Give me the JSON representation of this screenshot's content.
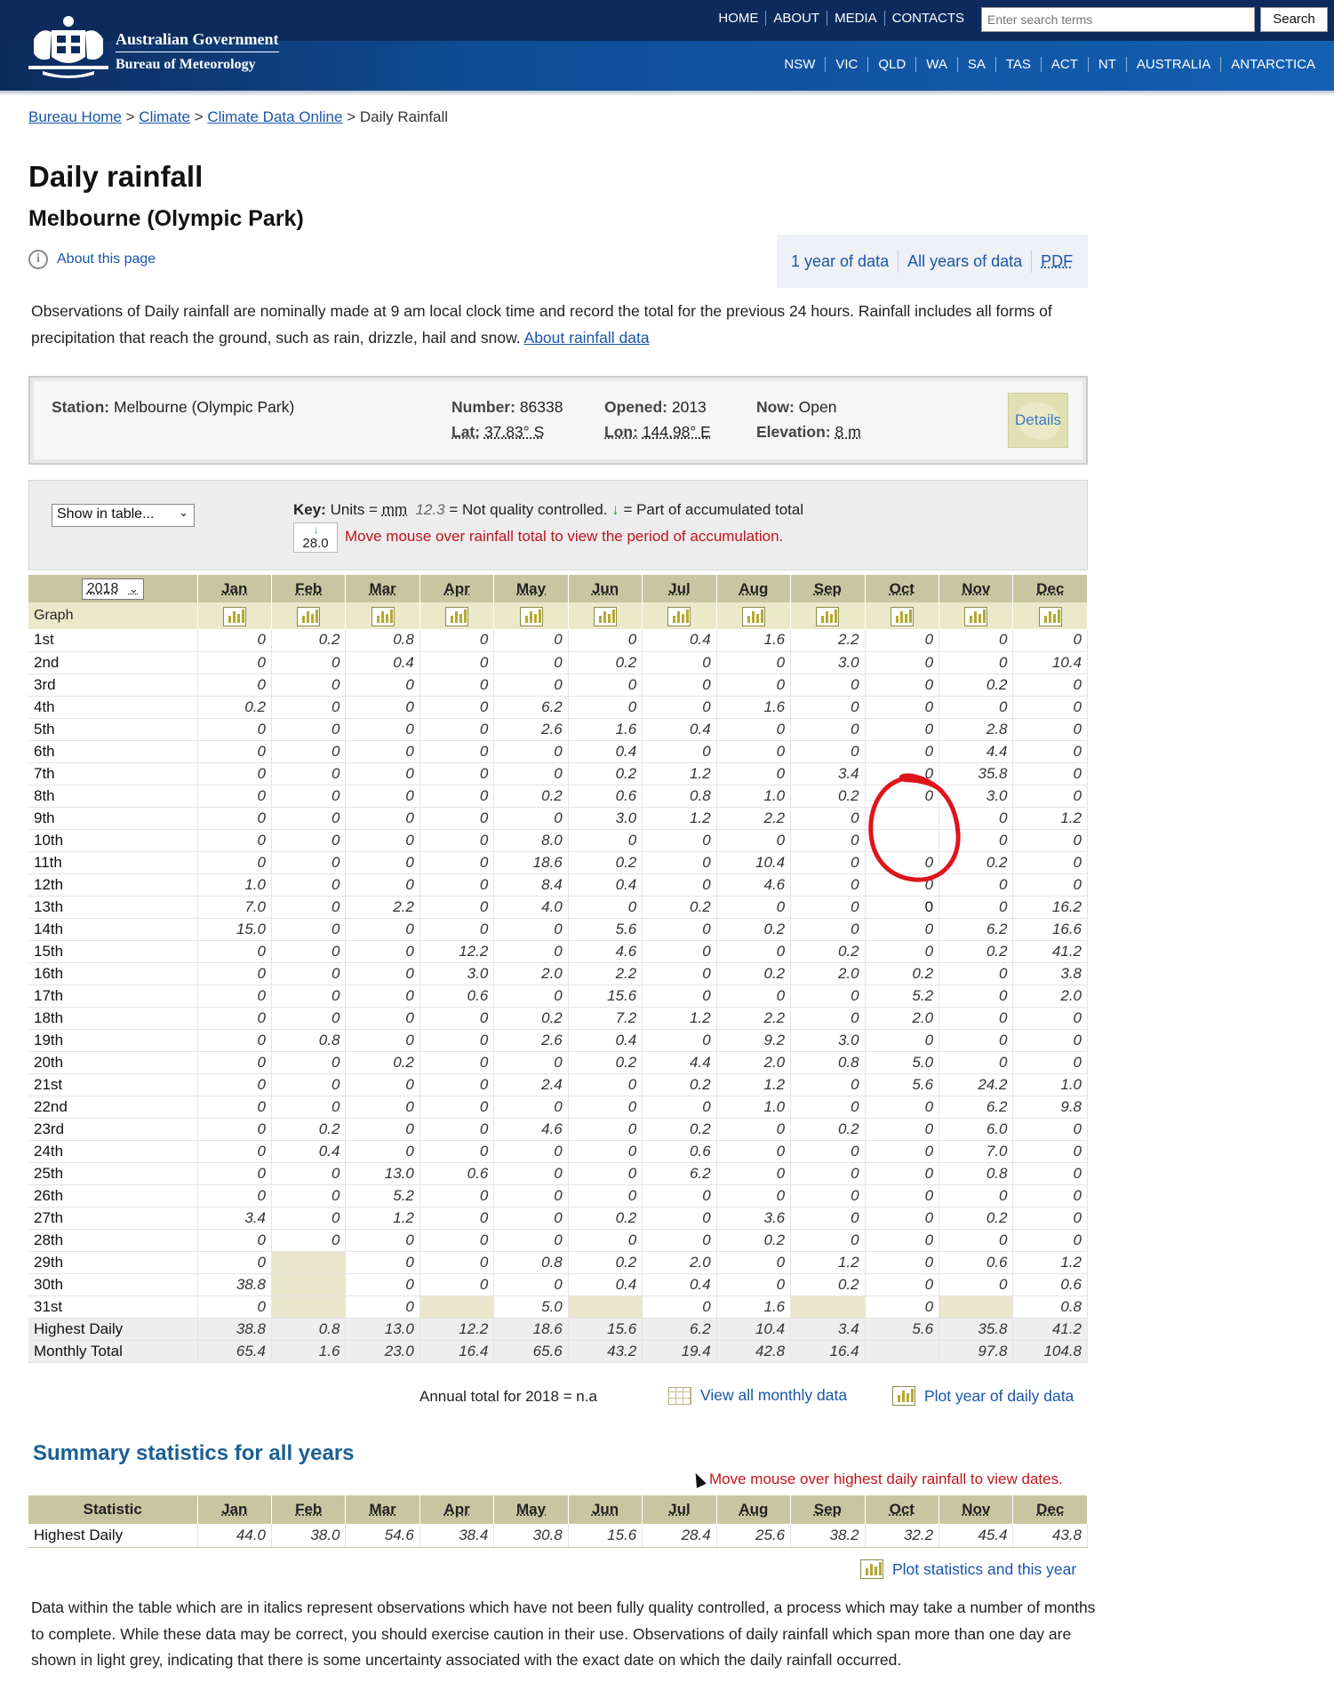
{
  "header": {
    "gov_title": "Australian Government",
    "gov_subtitle": "Bureau of Meteorology",
    "top_nav": [
      "HOME",
      "ABOUT",
      "MEDIA",
      "CONTACTS"
    ],
    "search_placeholder": "Enter search terms",
    "search_button": "Search",
    "state_nav": [
      "NSW",
      "VIC",
      "QLD",
      "WA",
      "SA",
      "TAS",
      "ACT",
      "NT",
      "AUSTRALIA",
      "ANTARCTICA"
    ]
  },
  "breadcrumb": {
    "home": "Bureau Home",
    "climate": "Climate",
    "cdo": "Climate Data Online",
    "sep": ">",
    "current": "Daily Rainfall"
  },
  "page": {
    "title": "Daily rainfall",
    "subtitle": "Melbourne (Olympic Park)",
    "about_link": "About this page",
    "link_1year": "1 year of data",
    "link_allyears": "All years of data",
    "link_pdf": "PDF",
    "intro": "Observations of Daily rainfall are nominally made at 9 am local clock time and record the total for the previous 24 hours. Rainfall includes all forms of precipitation that reach the ground, such as rain, drizzle, hail and snow.",
    "intro_link": "About rainfall data"
  },
  "station": {
    "station_label": "Station:",
    "station_value": "Melbourne (Olympic Park)",
    "number_label": "Number:",
    "number_value": "86338",
    "opened_label": "Opened:",
    "opened_value": "2013",
    "now_label": "Now:",
    "now_value": "Open",
    "lat_label": "Lat:",
    "lat_value": "37.83° S",
    "lon_label": "Lon:",
    "lon_value": "144.98° E",
    "elev_label": "Elevation:",
    "elev_value": "8 m",
    "details_button": "Details"
  },
  "key": {
    "show_select": "Show in table...",
    "key_label": "Key:",
    "units_text": "Units =",
    "units_value": "mm",
    "qc_example": "12.3",
    "qc_text": "= Not quality controlled.",
    "acc_arrow": "↓",
    "acc_text": "= Part of accumulated total",
    "acc_example": "28.0",
    "acc_msg": "Move mouse over rainfall total to view the period of accumulation."
  },
  "table": {
    "year": "2018",
    "graph_label": "Graph",
    "months": [
      "Jan",
      "Feb",
      "Mar",
      "Apr",
      "May",
      "Jun",
      "Jul",
      "Aug",
      "Sep",
      "Oct",
      "Nov",
      "Dec"
    ],
    "days": [
      {
        "d": "1st",
        "v": [
          "0",
          "0.2",
          "0.8",
          "0",
          "0",
          "0",
          "0.4",
          "1.6",
          "2.2",
          "0",
          "0",
          "0"
        ]
      },
      {
        "d": "2nd",
        "v": [
          "0",
          "0",
          "0.4",
          "0",
          "0",
          "0.2",
          "0",
          "0",
          "3.0",
          "0",
          "0",
          "10.4"
        ]
      },
      {
        "d": "3rd",
        "v": [
          "0",
          "0",
          "0",
          "0",
          "0",
          "0",
          "0",
          "0",
          "0",
          "0",
          "0.2",
          "0"
        ]
      },
      {
        "d": "4th",
        "v": [
          "0.2",
          "0",
          "0",
          "0",
          "6.2",
          "0",
          "0",
          "1.6",
          "0",
          "0",
          "0",
          "0"
        ]
      },
      {
        "d": "5th",
        "v": [
          "0",
          "0",
          "0",
          "0",
          "2.6",
          "1.6",
          "0.4",
          "0",
          "0",
          "0",
          "2.8",
          "0"
        ]
      },
      {
        "d": "6th",
        "v": [
          "0",
          "0",
          "0",
          "0",
          "0",
          "0.4",
          "0",
          "0",
          "0",
          "0",
          "4.4",
          "0"
        ]
      },
      {
        "d": "7th",
        "v": [
          "0",
          "0",
          "0",
          "0",
          "0",
          "0.2",
          "1.2",
          "0",
          "3.4",
          "0",
          "35.8",
          "0"
        ]
      },
      {
        "d": "8th",
        "v": [
          "0",
          "0",
          "0",
          "0",
          "0.2",
          "0.6",
          "0.8",
          "1.0",
          "0.2",
          "0",
          "3.0",
          "0"
        ]
      },
      {
        "d": "9th",
        "v": [
          "0",
          "0",
          "0",
          "0",
          "0",
          "3.0",
          "1.2",
          "2.2",
          "0",
          "",
          "0",
          "1.2"
        ]
      },
      {
        "d": "10th",
        "v": [
          "0",
          "0",
          "0",
          "0",
          "8.0",
          "0",
          "0",
          "0",
          "0",
          "",
          "0",
          "0"
        ]
      },
      {
        "d": "11th",
        "v": [
          "0",
          "0",
          "0",
          "0",
          "18.6",
          "0.2",
          "0",
          "10.4",
          "0",
          "0",
          "0.2",
          "0"
        ]
      },
      {
        "d": "12th",
        "v": [
          "1.0",
          "0",
          "0",
          "0",
          "8.4",
          "0.4",
          "0",
          "4.6",
          "0",
          "0",
          "0",
          "0"
        ]
      },
      {
        "d": "13th",
        "v": [
          "7.0",
          "0",
          "2.2",
          "0",
          "4.0",
          "0",
          "0.2",
          "0",
          "0",
          "0",
          "0",
          "16.2"
        ]
      },
      {
        "d": "14th",
        "v": [
          "15.0",
          "0",
          "0",
          "0",
          "0",
          "5.6",
          "0",
          "0.2",
          "0",
          "0",
          "6.2",
          "16.6"
        ]
      },
      {
        "d": "15th",
        "v": [
          "0",
          "0",
          "0",
          "12.2",
          "0",
          "4.6",
          "0",
          "0",
          "0.2",
          "0",
          "0.2",
          "41.2"
        ]
      },
      {
        "d": "16th",
        "v": [
          "0",
          "0",
          "0",
          "3.0",
          "2.0",
          "2.2",
          "0",
          "0.2",
          "2.0",
          "0.2",
          "0",
          "3.8"
        ]
      },
      {
        "d": "17th",
        "v": [
          "0",
          "0",
          "0",
          "0.6",
          "0",
          "15.6",
          "0",
          "0",
          "0",
          "5.2",
          "0",
          "2.0"
        ]
      },
      {
        "d": "18th",
        "v": [
          "0",
          "0",
          "0",
          "0",
          "0.2",
          "7.2",
          "1.2",
          "2.2",
          "0",
          "2.0",
          "0",
          "0"
        ]
      },
      {
        "d": "19th",
        "v": [
          "0",
          "0.8",
          "0",
          "0",
          "2.6",
          "0.4",
          "0",
          "9.2",
          "3.0",
          "0",
          "0",
          "0"
        ]
      },
      {
        "d": "20th",
        "v": [
          "0",
          "0",
          "0.2",
          "0",
          "0",
          "0.2",
          "4.4",
          "2.0",
          "0.8",
          "5.0",
          "0",
          "0"
        ]
      },
      {
        "d": "21st",
        "v": [
          "0",
          "0",
          "0",
          "0",
          "2.4",
          "0",
          "0.2",
          "1.2",
          "0",
          "5.6",
          "24.2",
          "1.0"
        ]
      },
      {
        "d": "22nd",
        "v": [
          "0",
          "0",
          "0",
          "0",
          "0",
          "0",
          "0",
          "1.0",
          "0",
          "0",
          "6.2",
          "9.8"
        ]
      },
      {
        "d": "23rd",
        "v": [
          "0",
          "0.2",
          "0",
          "0",
          "4.6",
          "0",
          "0.2",
          "0",
          "0.2",
          "0",
          "6.0",
          "0"
        ]
      },
      {
        "d": "24th",
        "v": [
          "0",
          "0.4",
          "0",
          "0",
          "0",
          "0",
          "0.6",
          "0",
          "0",
          "0",
          "7.0",
          "0"
        ]
      },
      {
        "d": "25th",
        "v": [
          "0",
          "0",
          "13.0",
          "0.6",
          "0",
          "0",
          "6.2",
          "0",
          "0",
          "0",
          "0.8",
          "0"
        ]
      },
      {
        "d": "26th",
        "v": [
          "0",
          "0",
          "5.2",
          "0",
          "0",
          "0",
          "0",
          "0",
          "0",
          "0",
          "0",
          "0"
        ]
      },
      {
        "d": "27th",
        "v": [
          "3.4",
          "0",
          "1.2",
          "0",
          "0",
          "0.2",
          "0",
          "3.6",
          "0",
          "0",
          "0.2",
          "0"
        ]
      },
      {
        "d": "28th",
        "v": [
          "0",
          "0",
          "0",
          "0",
          "0",
          "0",
          "0",
          "0.2",
          "0",
          "0",
          "0",
          "0"
        ]
      },
      {
        "d": "29th",
        "v": [
          "0",
          null,
          "0",
          "0",
          "0.8",
          "0.2",
          "2.0",
          "0",
          "1.2",
          "0",
          "0.6",
          "1.2"
        ]
      },
      {
        "d": "30th",
        "v": [
          "38.8",
          null,
          "0",
          "0",
          "0",
          "0.4",
          "0.4",
          "0",
          "0.2",
          "0",
          "0",
          "0.6"
        ]
      },
      {
        "d": "31st",
        "v": [
          "0",
          null,
          "0",
          null,
          "5.0",
          null,
          "0",
          "1.6",
          null,
          "0",
          null,
          "0.8"
        ]
      }
    ],
    "highest_label": "Highest Daily",
    "highest": [
      "38.8",
      "0.8",
      "13.0",
      "12.2",
      "18.6",
      "15.6",
      "6.2",
      "10.4",
      "3.4",
      "5.6",
      "35.8",
      "41.2"
    ],
    "total_label": "Monthly Total",
    "totals": [
      "65.4",
      "1.6",
      "23.0",
      "16.4",
      "65.6",
      "43.2",
      "19.4",
      "42.8",
      "16.4",
      "",
      "97.8",
      "104.8"
    ]
  },
  "below_table": {
    "annual": "Annual total for 2018 = n.a",
    "view_monthly": "View all monthly data",
    "plot_year": "Plot year of daily data"
  },
  "summary": {
    "heading": "Summary statistics for all years",
    "hover_msg": "Move mouse over highest daily rainfall to view dates.",
    "statistic_label": "Statistic",
    "row_label": "Highest Daily",
    "values": [
      "44.0",
      "38.0",
      "54.6",
      "38.4",
      "30.8",
      "15.6",
      "28.4",
      "25.6",
      "38.2",
      "32.2",
      "45.4",
      "43.8"
    ],
    "plot_stats": "Plot statistics and this year",
    "footnote": "Data within the table which are in italics represent observations which have not been fully quality controlled, a process which may take a number of months to complete. While these data may be correct, you should exercise caution in their use. Observations of daily rainfall which span more than one day are shown in light grey, indicating that there is some uncertainty associated with the exact date on which the daily rainfall occurred."
  },
  "colors": {
    "header_bg": "#0c2b5c",
    "table_header": "#c9c5a1",
    "link": "#1a55a8",
    "alert": "#c0141a",
    "annotation": "#e0131b"
  }
}
